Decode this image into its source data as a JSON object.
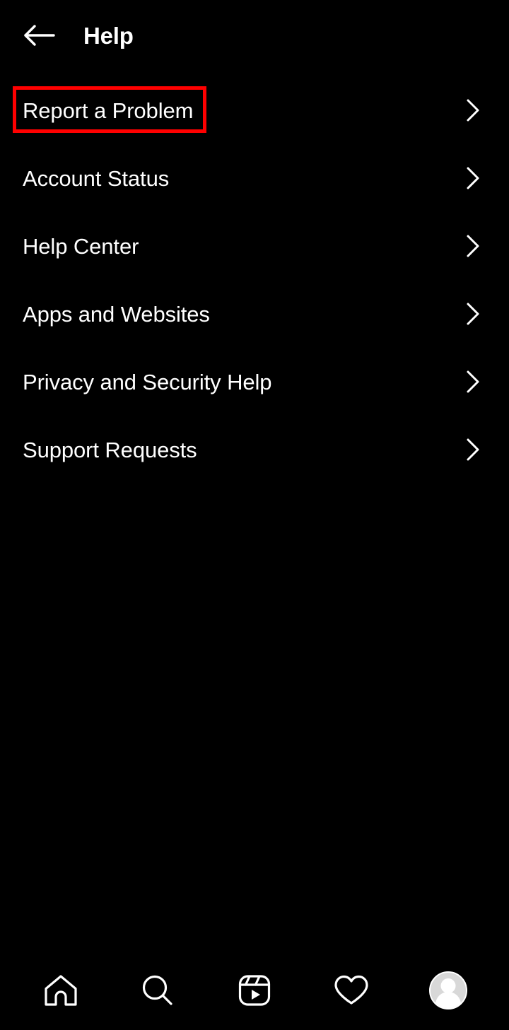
{
  "screen": {
    "background_color": "#000000",
    "text_color": "#ffffff"
  },
  "header": {
    "title": "Help",
    "back_icon": "arrow-left-icon"
  },
  "menu": {
    "chevron_icon": "chevron-right-icon",
    "items": [
      {
        "label": "Report a Problem",
        "highlighted": true
      },
      {
        "label": "Account Status",
        "highlighted": false
      },
      {
        "label": "Help Center",
        "highlighted": false
      },
      {
        "label": "Apps and Websites",
        "highlighted": false
      },
      {
        "label": "Privacy and Security Help",
        "highlighted": false
      },
      {
        "label": "Support Requests",
        "highlighted": false
      }
    ]
  },
  "highlight": {
    "color": "#ff0000",
    "target_label": "Report a Problem"
  },
  "bottom_nav": {
    "items": [
      {
        "icon": "home-icon",
        "label": "Home"
      },
      {
        "icon": "search-icon",
        "label": "Search"
      },
      {
        "icon": "reels-icon",
        "label": "Reels"
      },
      {
        "icon": "heart-icon",
        "label": "Activity"
      },
      {
        "icon": "profile-avatar-icon",
        "label": "Profile"
      }
    ]
  }
}
